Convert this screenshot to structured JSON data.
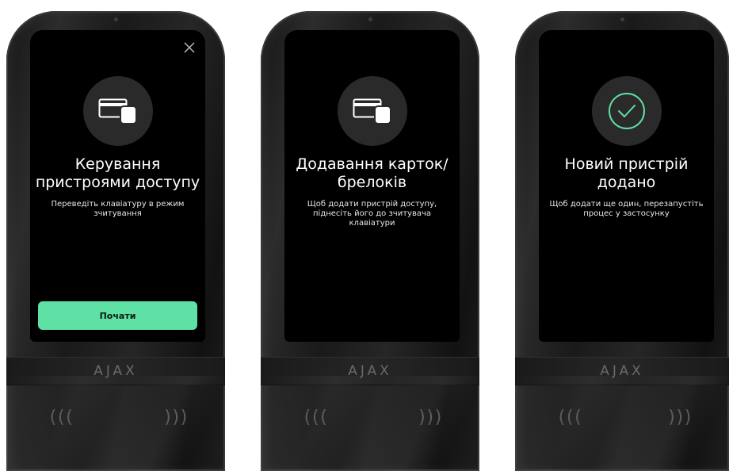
{
  "brand": "AJAX",
  "colors": {
    "accent": "#5fe0a5",
    "screen": "#000000",
    "icon_circle": "#2a2a2a"
  },
  "screens": [
    {
      "icon": "card-fob-icon",
      "title": "Керування пристроями доступу",
      "subtitle": "Переведіть клавіатуру в режим зчитування",
      "button_label": "Почати",
      "close_icon": "close-icon"
    },
    {
      "icon": "card-fob-icon",
      "title": "Додавання карток/ брелоків",
      "subtitle": "Щоб додати пристрій доступу, піднесіть його до зчитувача клавіатури"
    },
    {
      "icon": "check-circle-icon",
      "title": "Новий пристрій додано",
      "subtitle": "Щоб додати ще один, перезапустіть процес у застосунку"
    }
  ]
}
